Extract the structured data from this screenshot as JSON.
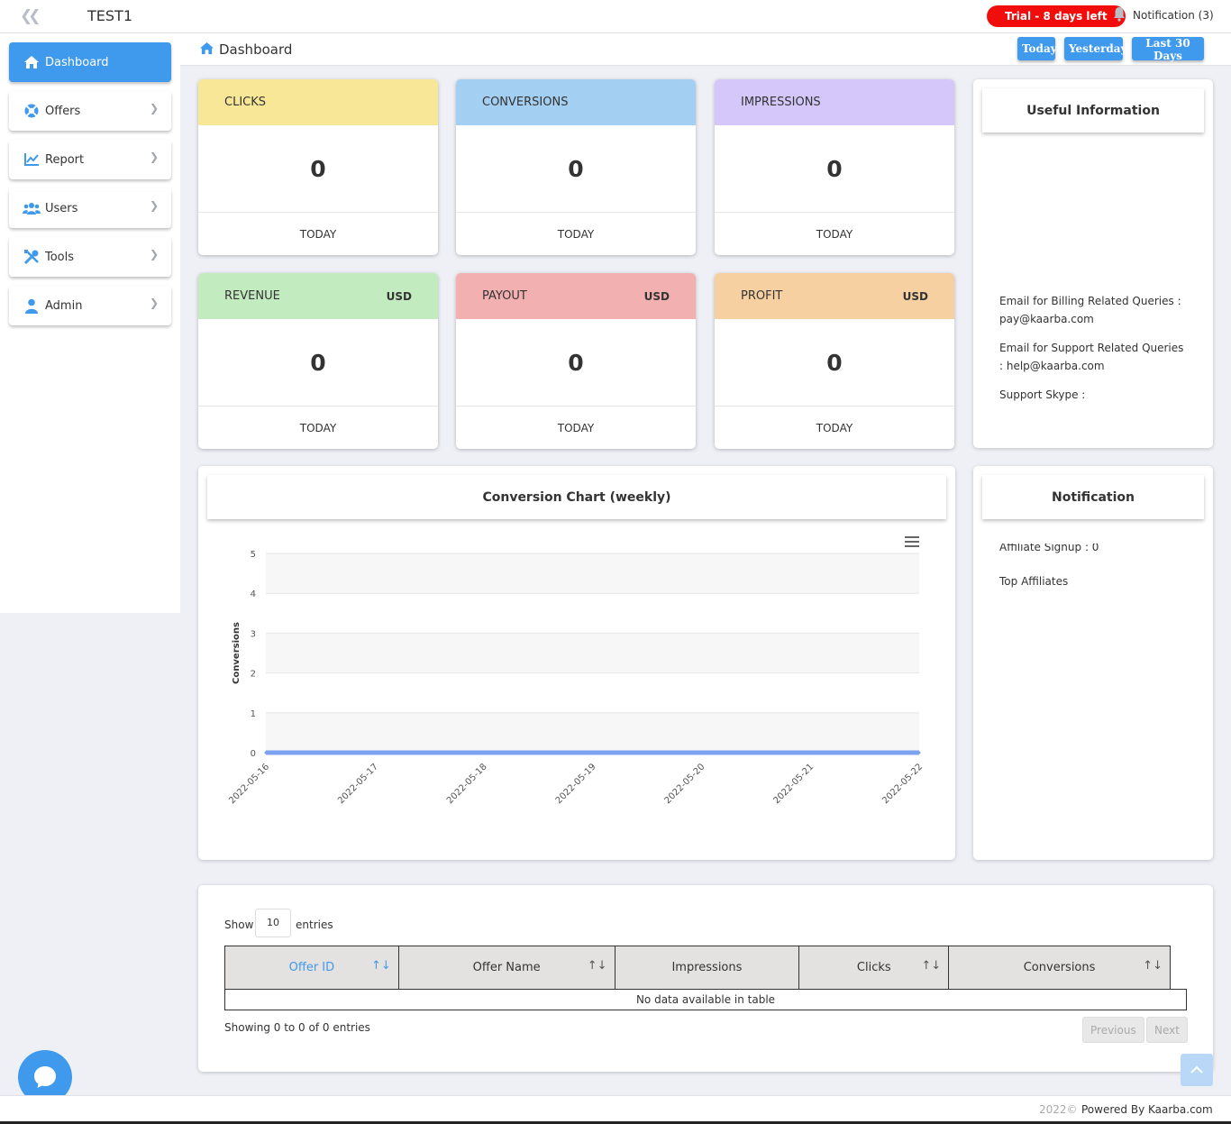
{
  "topbar": {
    "brand": "TEST1",
    "trial": "Trial - 8 days left",
    "notification": "Notification (3)"
  },
  "sidebar": {
    "items": [
      {
        "label": "Dashboard",
        "icon": "home-icon"
      },
      {
        "label": "Offers",
        "icon": "lifebuoy-icon"
      },
      {
        "label": "Report",
        "icon": "chart-line-icon"
      },
      {
        "label": "Users",
        "icon": "users-icon"
      },
      {
        "label": "Tools",
        "icon": "tools-icon"
      },
      {
        "label": "Admin",
        "icon": "user-icon"
      }
    ]
  },
  "header": {
    "title": "Dashboard",
    "ranges": [
      "Today",
      "Yesterday",
      "Last 30 Days"
    ]
  },
  "stats": [
    {
      "label": "CLICKS",
      "currency": "",
      "value": "0",
      "period": "TODAY",
      "color": "#f8e796"
    },
    {
      "label": "CONVERSIONS",
      "currency": "",
      "value": "0",
      "period": "TODAY",
      "color": "#a3cff2"
    },
    {
      "label": "IMPRESSIONS",
      "currency": "",
      "value": "0",
      "period": "TODAY",
      "color": "#d5c7f9"
    },
    {
      "label": "REVENUE",
      "currency": "USD",
      "value": "0",
      "period": "TODAY",
      "color": "#c2ebbf"
    },
    {
      "label": "PAYOUT",
      "currency": "USD",
      "value": "0",
      "period": "TODAY",
      "color": "#f3b0b0"
    },
    {
      "label": "PROFIT",
      "currency": "USD",
      "value": "0",
      "period": "TODAY",
      "color": "#f6d0a1"
    }
  ],
  "useful_info": {
    "title": "Useful Information",
    "billing_label": "Email for Billing Related Queries :",
    "billing_email": "pay@kaarba.com",
    "support_label": "Email for Support Related Queries",
    "support_email": ": help@kaarba.com",
    "skype_label": "Support Skype :"
  },
  "chart_panel": {
    "title": "Conversion Chart (weekly)"
  },
  "chart_data": {
    "type": "line",
    "x": [
      "2022-05-16",
      "2022-05-17",
      "2022-05-18",
      "2022-05-19",
      "2022-05-20",
      "2022-05-21",
      "2022-05-22"
    ],
    "series": [
      {
        "values": [
          0,
          0,
          0,
          0,
          0,
          0,
          0
        ]
      }
    ],
    "ylabel": "Conversions",
    "ylim": [
      0,
      5
    ],
    "yticks": [
      "0",
      "1",
      "2",
      "3",
      "4",
      "5"
    ],
    "grid": true,
    "series_color": "#7ca1f0"
  },
  "notification_panel": {
    "title": "Notification",
    "affiliate_signup": "Affiliate Signup : 0",
    "top_affiliates": "Top Affiliates"
  },
  "table": {
    "show_label": "Show",
    "show_value": "10",
    "entries_label": "entries",
    "columns": [
      "Offer ID",
      "Offer Name",
      "Impressions",
      "Clicks",
      "Conversions"
    ],
    "empty": "No data available in table",
    "info": "Showing 0 to 0 of 0 entries",
    "previous": "Previous",
    "next": "Next"
  },
  "footer": {
    "copyright": "2022©",
    "powered": "Powered By Kaarba.com"
  },
  "colors": {
    "primary": "#3f9aee",
    "trial": "#f20d0d"
  }
}
